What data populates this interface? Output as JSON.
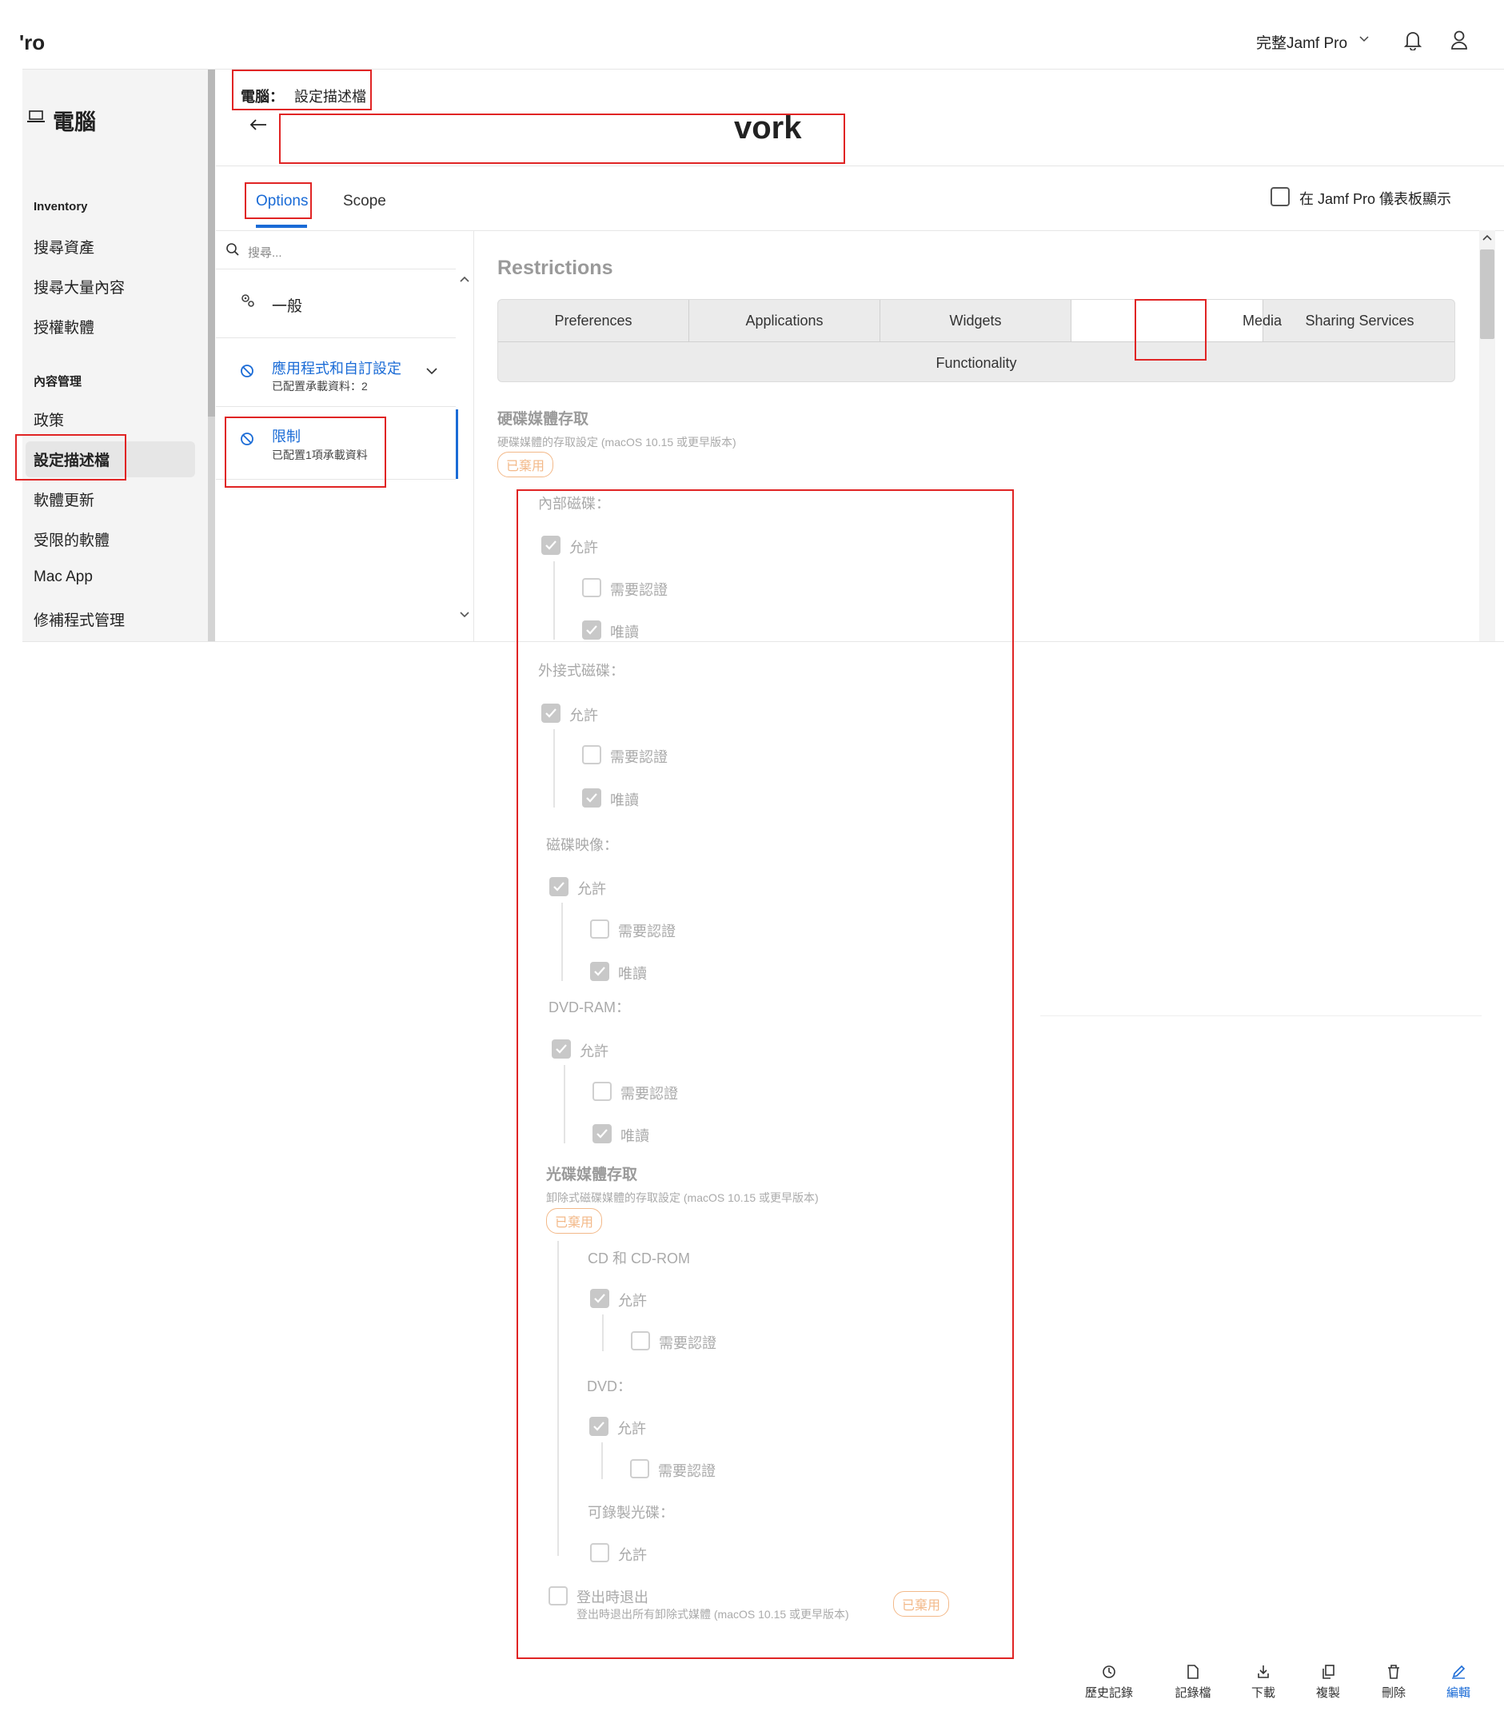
{
  "topbar": {
    "brand": "'ro",
    "environment": "完整Jamf Pro",
    "icons": [
      "chevron-down-icon",
      "bell-icon",
      "user-icon"
    ]
  },
  "sidebar": {
    "heading": "電腦",
    "section_inventory": "Inventory",
    "inventory_items": [
      "搜尋資產",
      "搜尋大量內容",
      "授權軟體"
    ],
    "section_content": "內容管理",
    "content_items": [
      "政策",
      "設定描述檔",
      "軟體更新",
      "受限的軟體",
      "Mac App",
      "修補程式管理"
    ],
    "selected": "設定描述檔"
  },
  "header": {
    "breadcrumb_root": "電腦：",
    "breadcrumb_current": "設定描述檔",
    "title_visible": "vork"
  },
  "tabs": {
    "options": "Options",
    "scope": "Scope",
    "dashboard_label": "在 Jamf Pro 儀表板顯示"
  },
  "payloads": {
    "search_placeholder": "搜尋...",
    "general": "一般",
    "apps": "應用程式和自訂設定",
    "apps_sub": "已配置承載資料：2",
    "restrictions": "限制",
    "restrictions_sub": "已配置1項承載資料"
  },
  "content": {
    "title": "Restrictions",
    "subtabs": [
      "Preferences",
      "Applications",
      "Widgets",
      "",
      "Media",
      "Sharing Services"
    ],
    "subtab_row2": "Functionality",
    "active_subtab": "Media",
    "hd_title": "硬碟媒體存取",
    "hd_desc": "硬碟媒體的存取設定 (macOS 10.15 或更早版本)",
    "disabled_badge": "已棄用",
    "internal": "內部磁碟：",
    "external": "外接式磁碟：",
    "disk_image": "磁碟映像：",
    "dvdram": "DVD-RAM：",
    "allow": "允許",
    "require_auth": "需要認證",
    "read_only": "唯讀",
    "od_title": "光碟媒體存取",
    "od_desc": "卸除式磁碟媒體的存取設定 (macOS 10.15 或更早版本)",
    "cd": "CD 和 CD-ROM",
    "dvd": "DVD：",
    "recordable": "可錄製光碟：",
    "logout_eject": "登出時退出",
    "logout_desc": "登出時退出所有卸除式媒體 (macOS 10.15 或更早版本)"
  },
  "actions": {
    "history": "歷史記錄",
    "logs": "記錄檔",
    "download": "下載",
    "clone": "複製",
    "delete": "刪除",
    "edit": "編輯"
  },
  "colors": {
    "accent": "#1a6bd6",
    "highlight": "#e02424",
    "deprecated": "#f3b989"
  }
}
